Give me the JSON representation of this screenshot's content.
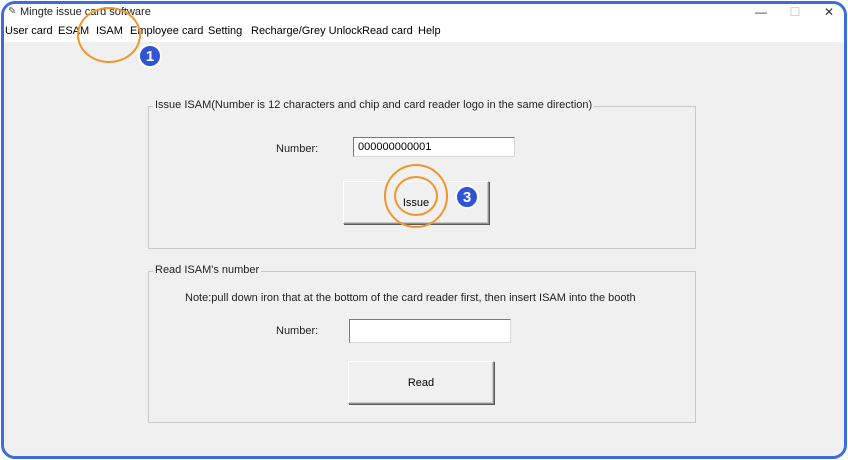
{
  "window": {
    "title": "Mingte issue card software",
    "minimize_glyph": "—",
    "maximize_glyph": "☐",
    "close_glyph": "✕",
    "app_icon": "feather-pen-icon"
  },
  "menu": {
    "items": [
      "User card",
      "ESAM",
      "ISAM",
      "Employee card",
      "Setting",
      "Recharge/Grey Unlock",
      "Read card",
      "Help"
    ]
  },
  "issue_group": {
    "title": "Issue ISAM(Number is 12 characters and chip and card reader logo in the same direction)",
    "number_label": "Number:",
    "number_value": "000000000001",
    "issue_button": "Issue"
  },
  "read_group": {
    "title": "Read ISAM's number",
    "note": "Note:pull down iron that at the bottom of the card reader first, then insert ISAM into the booth",
    "number_label": "Number:",
    "number_value": "",
    "read_button": "Read"
  },
  "annotations": {
    "badge_1": "1",
    "badge_3": "3",
    "highlight_color": "#f0962a",
    "badge_color": "#2f55d4",
    "frame_color": "#3d6ce0"
  }
}
